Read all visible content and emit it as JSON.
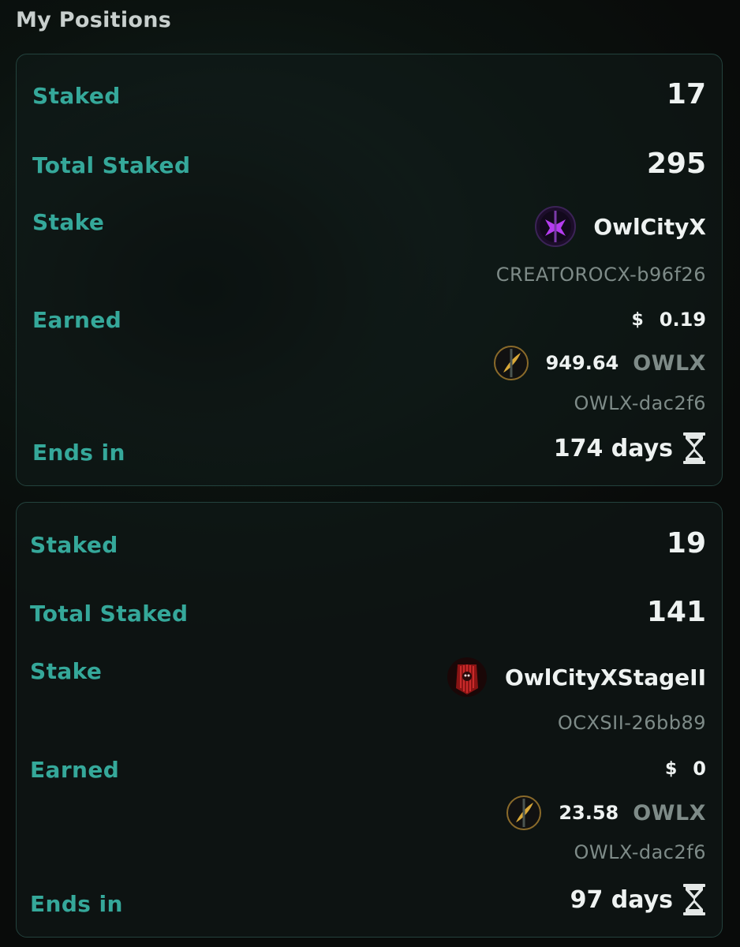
{
  "page": {
    "title": "My Positions"
  },
  "labels": {
    "staked": "Staked",
    "total_staked": "Total Staked",
    "stake": "Stake",
    "earned": "Earned",
    "ends_in": "Ends in"
  },
  "icons": {
    "usd": "dollar-sign",
    "time": "hourglass-icon",
    "token": "owlx-feather-token-icon"
  },
  "positions": [
    {
      "staked": "17",
      "total_staked": "295",
      "stake_name": "OwlCityX",
      "stake_token_id": "CREATOROCX-b96f26",
      "stake_avatar_icon": "owlcityx-purple-avatar",
      "earned_usd_symbol": "$",
      "earned_usd": "0.19",
      "earned_amount": "949.64",
      "earned_token": "OWLX",
      "earned_token_id": "OWLX-dac2f6",
      "ends_in": "174 days"
    },
    {
      "staked": "19",
      "total_staked": "141",
      "stake_name": "OwlCityXStageII",
      "stake_token_id": "OCXSII-26bb89",
      "stake_avatar_icon": "owlcityx-stageii-red-avatar",
      "earned_usd_symbol": "$",
      "earned_usd": "0",
      "earned_amount": "23.58",
      "earned_token": "OWLX",
      "earned_token_id": "OWLX-dac2f6",
      "ends_in": "97 days"
    }
  ],
  "colors": {
    "label_teal": "#35a89a",
    "value_white": "#eef2f1",
    "muted_gray": "#7e8b88",
    "card_border": "#23423d"
  }
}
